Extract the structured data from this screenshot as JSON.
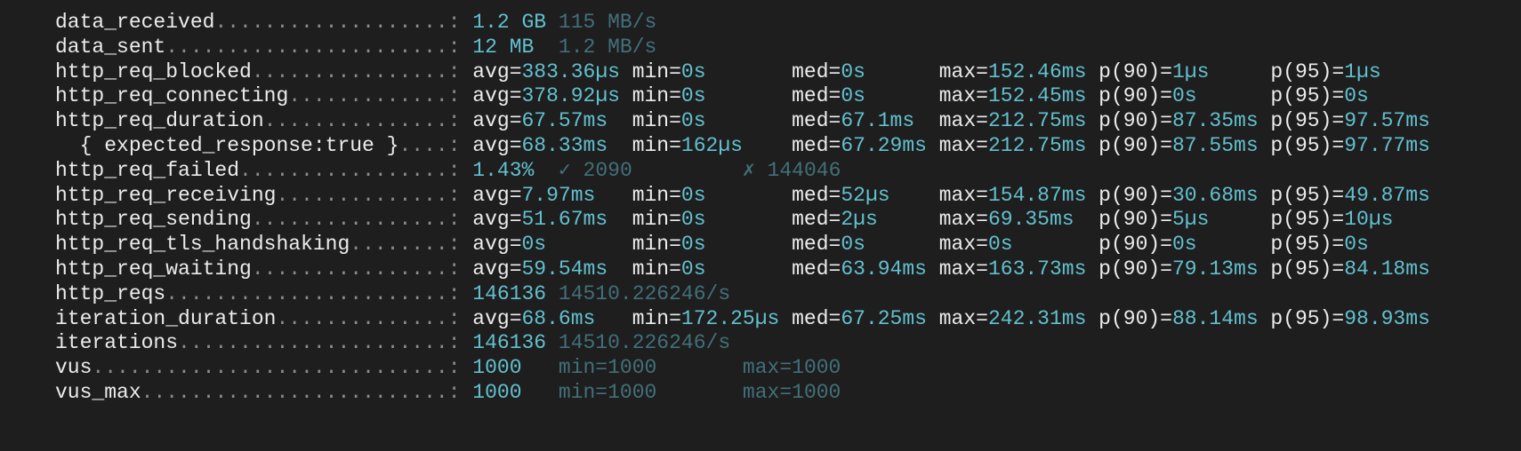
{
  "colors": {
    "background": "#1e1e1e",
    "text": "#ececec",
    "value": "#62c0cf",
    "dim": "#41707a",
    "dots": "#8c8c8c"
  },
  "metrics": [
    {
      "name": "data_received",
      "type": "rate",
      "value": "1.2 GB",
      "rate": "115 MB/s"
    },
    {
      "name": "data_sent",
      "type": "rate",
      "value": "12 MB",
      "rate": "1.2 MB/s"
    },
    {
      "name": "http_req_blocked",
      "type": "stat",
      "avg": "383.36µs",
      "min": "0s",
      "med": "0s",
      "max": "152.46ms",
      "p90": "1µs",
      "p95": "1µs"
    },
    {
      "name": "http_req_connecting",
      "type": "stat",
      "avg": "378.92µs",
      "min": "0s",
      "med": "0s",
      "max": "152.45ms",
      "p90": "0s",
      "p95": "0s"
    },
    {
      "name": "http_req_duration",
      "type": "stat",
      "avg": "67.57ms",
      "min": "0s",
      "med": "67.1ms",
      "max": "212.75ms",
      "p90": "87.35ms",
      "p95": "97.57ms"
    },
    {
      "name": "  { expected_response:true }",
      "type": "stat",
      "avg": "68.33ms",
      "min": "162µs",
      "med": "67.29ms",
      "max": "212.75ms",
      "p90": "87.55ms",
      "p95": "97.77ms"
    },
    {
      "name": "http_req_failed",
      "type": "failed",
      "value": "1.43%",
      "pass": "✓ 2090",
      "fail": "✗ 144046"
    },
    {
      "name": "http_req_receiving",
      "type": "stat",
      "avg": "7.97ms",
      "min": "0s",
      "med": "52µs",
      "max": "154.87ms",
      "p90": "30.68ms",
      "p95": "49.87ms"
    },
    {
      "name": "http_req_sending",
      "type": "stat",
      "avg": "51.67ms",
      "min": "0s",
      "med": "2µs",
      "max": "69.35ms",
      "p90": "5µs",
      "p95": "10µs"
    },
    {
      "name": "http_req_tls_handshaking",
      "type": "stat",
      "avg": "0s",
      "min": "0s",
      "med": "0s",
      "max": "0s",
      "p90": "0s",
      "p95": "0s"
    },
    {
      "name": "http_req_waiting",
      "type": "stat",
      "avg": "59.54ms",
      "min": "0s",
      "med": "63.94ms",
      "max": "163.73ms",
      "p90": "79.13ms",
      "p95": "84.18ms"
    },
    {
      "name": "http_reqs",
      "type": "rate",
      "value": "146136",
      "rate": "14510.226246/s"
    },
    {
      "name": "iteration_duration",
      "type": "stat",
      "avg": "68.6ms",
      "min": "172.25µs",
      "med": "67.25ms",
      "max": "242.31ms",
      "p90": "88.14ms",
      "p95": "98.93ms"
    },
    {
      "name": "iterations",
      "type": "rate",
      "value": "146136",
      "rate": "14510.226246/s"
    },
    {
      "name": "vus",
      "type": "vus",
      "value": "1000",
      "min": "1000",
      "max": "1000"
    },
    {
      "name": "vus_max",
      "type": "vus",
      "value": "1000",
      "min": "1000",
      "max": "1000"
    }
  ]
}
